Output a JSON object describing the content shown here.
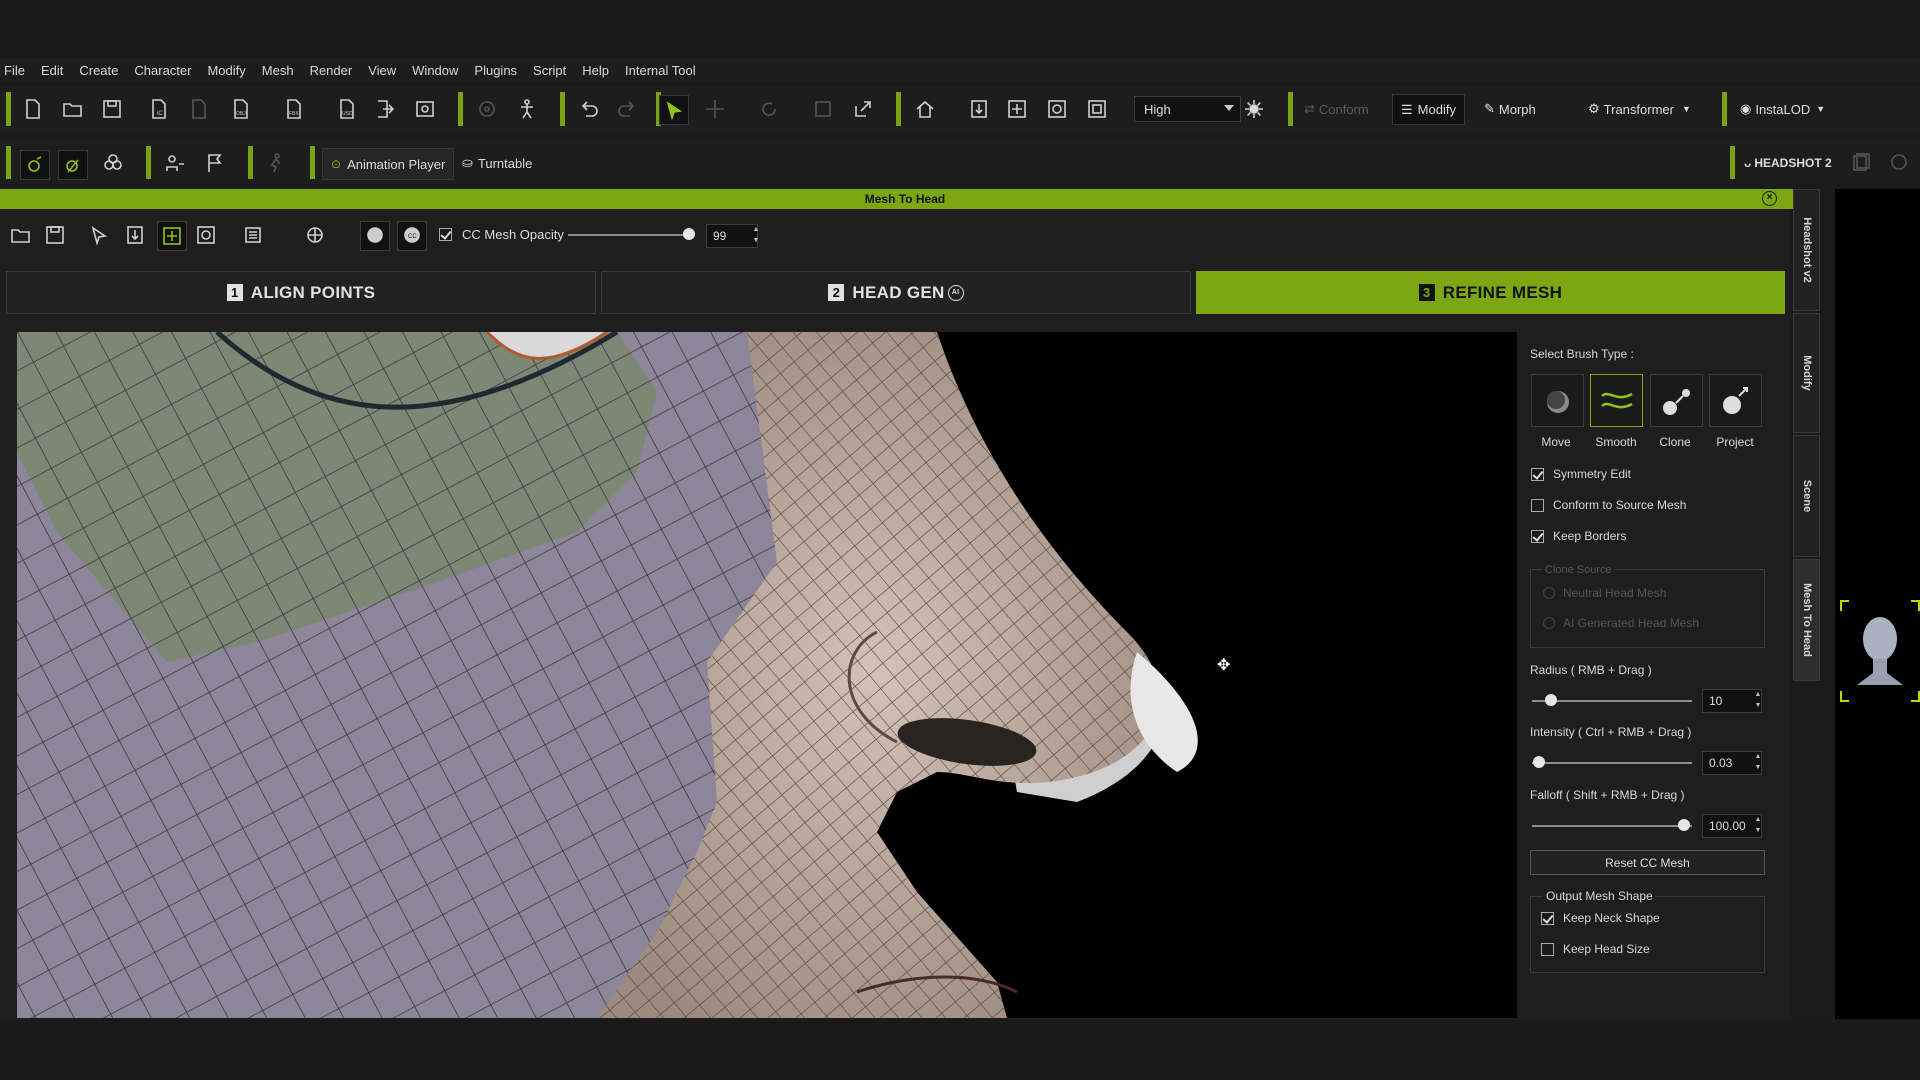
{
  "menu": [
    "File",
    "Edit",
    "Create",
    "Character",
    "Modify",
    "Mesh",
    "Render",
    "View",
    "Window",
    "Plugins",
    "Script",
    "Help",
    "Internal Tool"
  ],
  "toolbar": {
    "quality_select": "High",
    "conform_label": "Conform",
    "modify_label": "Modify",
    "morph_label": "Morph",
    "transformer_label": "Transformer",
    "instalod_label": "InstaLOD",
    "animation_player_label": "Animation Player",
    "turntable_label": "Turntable",
    "headshot_label": "HEADSHOT 2"
  },
  "panel": {
    "title": "Mesh To Head",
    "opacity_label": "CC Mesh Opacity",
    "opacity_value": "99",
    "opacity_fraction": 0.99
  },
  "steps": [
    {
      "num": "1",
      "label": "ALIGN POINTS"
    },
    {
      "num": "2",
      "label": "HEAD GEN"
    },
    {
      "num": "3",
      "label": "REFINE MESH"
    }
  ],
  "head_gen_badge": "AI",
  "settings": {
    "brush_type_label": "Select Brush Type :",
    "brushes": [
      "Move",
      "Smooth",
      "Clone",
      "Project"
    ],
    "active_brush": "Smooth",
    "symmetry_edit": "Symmetry Edit",
    "conform_to_source": "Conform to Source Mesh",
    "keep_borders": "Keep Borders",
    "clone_source_title": "Clone Source",
    "clone_source_options": [
      "Neutral Head Mesh",
      "AI Generated Head Mesh"
    ],
    "radius_label": "Radius ( RMB + Drag )",
    "radius_value": "10",
    "intensity_label": "Intensity ( Ctrl + RMB + Drag )",
    "intensity_value": "0.03",
    "falloff_label": "Falloff ( Shift + RMB + Drag )",
    "falloff_value": "100.00",
    "reset_label": "Reset CC Mesh",
    "output_shape_title": "Output Mesh Shape",
    "keep_neck_shape": "Keep Neck Shape",
    "keep_head_size": "Keep Head Size"
  },
  "side_tabs": [
    "Headshot v2",
    "Modify",
    "Scene",
    "Mesh To Head"
  ],
  "colors": {
    "accent": "#7ca712",
    "viewport_bg": "#000000"
  }
}
